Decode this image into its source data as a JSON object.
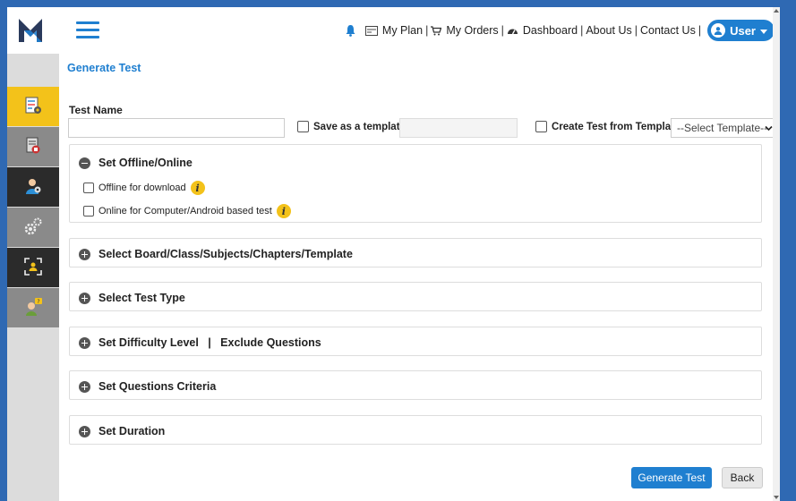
{
  "nav": {
    "my_plan": "My Plan",
    "my_orders": "My Orders",
    "dashboard": "Dashboard",
    "about_us": "About Us",
    "contact_us": "Contact Us",
    "user": "User",
    "sep": "|"
  },
  "page": {
    "title": "Generate Test",
    "test_name_label": "Test Name",
    "save_as_template": "Save as a template",
    "create_from_template": "Create Test from Template",
    "select_template": "--Select Template--"
  },
  "sections": {
    "offline_online": {
      "title": "Set Offline/Online",
      "option_offline": "Offline for download",
      "option_online": "Online for Computer/Android based test",
      "info": "i"
    },
    "board": "Select Board/Class/Subjects/Chapters/Template",
    "test_type": "Select Test Type",
    "difficulty": "Set Difficulty Level   |   Exclude Questions",
    "criteria": "Set Questions Criteria",
    "duration": "Set Duration"
  },
  "buttons": {
    "generate": "Generate Test",
    "back": "Back"
  },
  "icons": {
    "logo": "logo-m-icon",
    "menu": "hamburger-icon",
    "bell": "bell-icon",
    "plan": "card-icon",
    "cart": "cart-icon",
    "dashboard": "dashboard-icon",
    "user": "user-icon",
    "sidebar": [
      "test-icon",
      "report-icon",
      "student-icon",
      "settings-icon",
      "scan-icon",
      "help-icon"
    ]
  },
  "colors": {
    "accent": "#1f7fd0",
    "sidebar_active": "#f3c21a",
    "sidebar_dark": "#2b2b2b",
    "sidebar_gray": "#8a8a8a"
  }
}
